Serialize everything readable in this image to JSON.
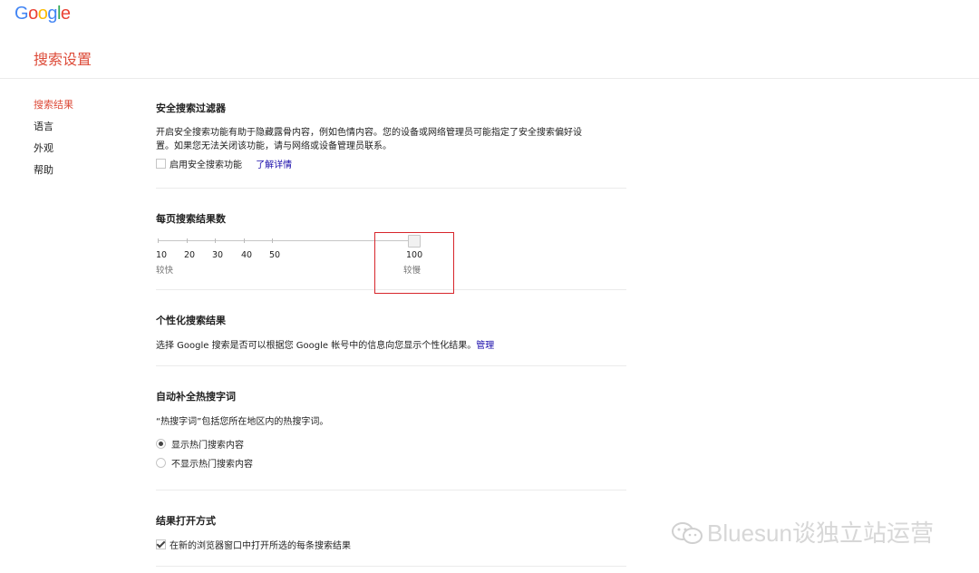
{
  "logo": {
    "text": "Google"
  },
  "header": {
    "title": "搜索设置"
  },
  "sidebar": {
    "items": [
      {
        "label": "搜索结果"
      },
      {
        "label": "语言"
      },
      {
        "label": "外观"
      },
      {
        "label": "帮助"
      }
    ]
  },
  "safe_search": {
    "title": "安全搜索过滤器",
    "desc_line1": "开启安全搜索功能有助于隐藏露骨内容，例如色情内容。您的设备或网络管理员可能指定了安全搜索偏好设",
    "desc_line2": "置。如果您无法关闭该功能，请与网络或设备管理员联系。",
    "checkbox_label": "启用安全搜索功能",
    "checked": false,
    "learn_more": "了解详情"
  },
  "results_per_page": {
    "title": "每页搜索结果数",
    "ticks": [
      "10",
      "20",
      "30",
      "40",
      "50",
      "100"
    ],
    "selected": "100",
    "faster_label": "较快",
    "slower_label": "较慢"
  },
  "personalized": {
    "title": "个性化搜索结果",
    "desc": "选择 Google 搜索是否可以根据您 Google 帐号中的信息向您显示个性化结果。",
    "manage": "管理"
  },
  "autocomplete": {
    "title": "自动补全热搜字词",
    "desc": "“热搜字词”包括您所在地区内的热搜字词。",
    "option_show": "显示热门搜索内容",
    "option_hide": "不显示热门搜索内容",
    "selected": "show"
  },
  "open_results": {
    "title": "结果打开方式",
    "checkbox_label": "在新的浏览器窗口中打开所选的每条搜索结果",
    "checked": true
  },
  "watermark": {
    "text": "Bluesun谈独立站运营"
  },
  "colors": {
    "accent_red": "#dd4b39",
    "link_blue": "#1a0dab",
    "highlight_red": "#d7252b"
  }
}
